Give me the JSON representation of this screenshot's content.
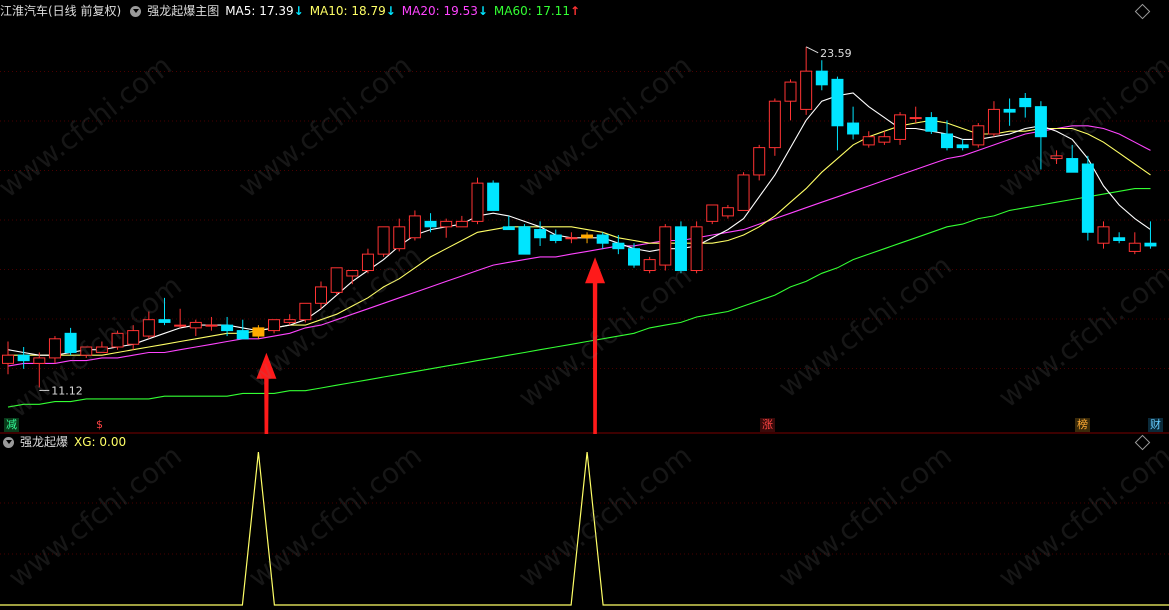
{
  "header": {
    "stock_name": "江淮汽车(日线 前复权)",
    "indicator_name": "强龙起爆主图",
    "ma": [
      {
        "label": "MA5: 17.39",
        "arrow": "↓",
        "color": "#ffffff",
        "arrow_color": "#00e5ff"
      },
      {
        "label": "MA10: 18.79",
        "arrow": "↓",
        "color": "#ffff66",
        "arrow_color": "#00e5ff"
      },
      {
        "label": "MA20: 19.53",
        "arrow": "↓",
        "color": "#ff44ff",
        "arrow_color": "#00e5ff"
      },
      {
        "label": "MA60: 17.11",
        "arrow": "↑",
        "color": "#33ff33",
        "arrow_color": "#ff3333"
      }
    ]
  },
  "sub_header": {
    "indicator_name": "强龙起爆",
    "xg_label": "XG: 0.00"
  },
  "badges": [
    {
      "text": "减",
      "color": "#33ff99"
    },
    {
      "text": "$",
      "color": "#ff4444"
    },
    {
      "text": "涨",
      "color": "#ff4444"
    },
    {
      "text": "榜",
      "color": "#ffaa33"
    },
    {
      "text": "财",
      "color": "#66ccff"
    }
  ],
  "watermark": "www.cfchi.com",
  "colors": {
    "up": "#ff3333",
    "down": "#00e5ff",
    "signal": "#ffaa00",
    "grid": "#4a0000",
    "ma5": "#ffffff",
    "ma10": "#ffff66",
    "ma20": "#ff44ff",
    "ma60": "#33ff33",
    "xg_line": "#ffff66",
    "arrow": "#ff1a1a"
  },
  "chart_data": [
    {
      "type": "candlestick",
      "title": "",
      "ylim": [
        10.0,
        24.5
      ],
      "high_label": "23.59",
      "low_label": "11.12",
      "candles": [
        {
          "o": 12.0,
          "h": 12.8,
          "l": 11.6,
          "c": 12.3
        },
        {
          "o": 12.3,
          "h": 12.6,
          "l": 11.8,
          "c": 12.1
        },
        {
          "o": 12.0,
          "h": 12.4,
          "l": 11.12,
          "c": 12.2
        },
        {
          "o": 12.2,
          "h": 13.0,
          "l": 12.0,
          "c": 12.9
        },
        {
          "o": 13.1,
          "h": 13.3,
          "l": 12.3,
          "c": 12.4
        },
        {
          "o": 12.3,
          "h": 12.6,
          "l": 12.2,
          "c": 12.6
        },
        {
          "o": 12.4,
          "h": 12.8,
          "l": 12.4,
          "c": 12.6
        },
        {
          "o": 12.6,
          "h": 13.2,
          "l": 12.5,
          "c": 13.1
        },
        {
          "o": 12.7,
          "h": 13.4,
          "l": 12.5,
          "c": 13.2
        },
        {
          "o": 13.0,
          "h": 13.9,
          "l": 12.9,
          "c": 13.6
        },
        {
          "o": 13.6,
          "h": 14.4,
          "l": 13.4,
          "c": 13.5
        },
        {
          "o": 13.4,
          "h": 14.0,
          "l": 13.3,
          "c": 13.4
        },
        {
          "o": 13.3,
          "h": 13.6,
          "l": 13.0,
          "c": 13.5
        },
        {
          "o": 13.4,
          "h": 13.7,
          "l": 13.2,
          "c": 13.4
        },
        {
          "o": 13.4,
          "h": 13.7,
          "l": 13.0,
          "c": 13.2
        },
        {
          "o": 13.2,
          "h": 13.6,
          "l": 12.9,
          "c": 12.9
        },
        {
          "o": 13.0,
          "h": 13.4,
          "l": 12.9,
          "c": 13.3
        },
        {
          "o": 13.2,
          "h": 13.6,
          "l": 13.1,
          "c": 13.6
        },
        {
          "o": 13.5,
          "h": 13.8,
          "l": 13.4,
          "c": 13.6
        },
        {
          "o": 13.6,
          "h": 14.2,
          "l": 13.5,
          "c": 14.2
        },
        {
          "o": 14.2,
          "h": 15.0,
          "l": 14.0,
          "c": 14.8
        },
        {
          "o": 14.6,
          "h": 15.5,
          "l": 14.5,
          "c": 15.5
        },
        {
          "o": 15.2,
          "h": 15.4,
          "l": 14.9,
          "c": 15.4
        },
        {
          "o": 15.4,
          "h": 16.2,
          "l": 15.3,
          "c": 16.0
        },
        {
          "o": 16.0,
          "h": 17.0,
          "l": 15.9,
          "c": 17.0
        },
        {
          "o": 16.2,
          "h": 17.3,
          "l": 16.1,
          "c": 17.0
        },
        {
          "o": 16.6,
          "h": 17.6,
          "l": 16.5,
          "c": 17.4
        },
        {
          "o": 17.2,
          "h": 17.5,
          "l": 16.8,
          "c": 17.0
        },
        {
          "o": 17.0,
          "h": 17.3,
          "l": 16.6,
          "c": 17.2
        },
        {
          "o": 17.0,
          "h": 17.4,
          "l": 17.0,
          "c": 17.2
        },
        {
          "o": 17.2,
          "h": 18.8,
          "l": 17.1,
          "c": 18.6
        },
        {
          "o": 18.6,
          "h": 18.7,
          "l": 17.6,
          "c": 17.6
        },
        {
          "o": 17.0,
          "h": 17.4,
          "l": 16.9,
          "c": 16.9
        },
        {
          "o": 17.0,
          "h": 17.1,
          "l": 16.0,
          "c": 16.0
        },
        {
          "o": 16.9,
          "h": 17.2,
          "l": 16.3,
          "c": 16.6
        },
        {
          "o": 16.7,
          "h": 16.9,
          "l": 16.4,
          "c": 16.5
        },
        {
          "o": 16.6,
          "h": 16.8,
          "l": 16.4,
          "c": 16.6
        },
        {
          "o": 16.6,
          "h": 16.8,
          "l": 16.4,
          "c": 16.7
        },
        {
          "o": 16.7,
          "h": 16.8,
          "l": 16.2,
          "c": 16.4
        },
        {
          "o": 16.4,
          "h": 16.7,
          "l": 16.0,
          "c": 16.2
        },
        {
          "o": 16.2,
          "h": 16.4,
          "l": 15.5,
          "c": 15.6
        },
        {
          "o": 15.4,
          "h": 15.9,
          "l": 15.3,
          "c": 15.8
        },
        {
          "o": 15.6,
          "h": 17.1,
          "l": 15.4,
          "c": 17.0
        },
        {
          "o": 17.0,
          "h": 17.2,
          "l": 15.3,
          "c": 15.4
        },
        {
          "o": 15.4,
          "h": 17.2,
          "l": 15.3,
          "c": 17.0
        },
        {
          "o": 17.2,
          "h": 17.8,
          "l": 17.1,
          "c": 17.8
        },
        {
          "o": 17.4,
          "h": 17.8,
          "l": 17.3,
          "c": 17.7
        },
        {
          "o": 17.6,
          "h": 19.0,
          "l": 17.6,
          "c": 18.9
        },
        {
          "o": 18.9,
          "h": 20.0,
          "l": 18.7,
          "c": 19.9
        },
        {
          "o": 19.9,
          "h": 21.7,
          "l": 19.6,
          "c": 21.6
        },
        {
          "o": 21.6,
          "h": 22.4,
          "l": 20.9,
          "c": 22.3
        },
        {
          "o": 21.3,
          "h": 23.59,
          "l": 21.1,
          "c": 22.7
        },
        {
          "o": 22.7,
          "h": 23.1,
          "l": 22.0,
          "c": 22.2
        },
        {
          "o": 22.4,
          "h": 22.5,
          "l": 19.8,
          "c": 20.7
        },
        {
          "o": 20.8,
          "h": 21.4,
          "l": 20.2,
          "c": 20.4
        },
        {
          "o": 20.0,
          "h": 20.5,
          "l": 19.9,
          "c": 20.3
        },
        {
          "o": 20.1,
          "h": 20.5,
          "l": 20.0,
          "c": 20.3
        },
        {
          "o": 20.2,
          "h": 21.2,
          "l": 20.0,
          "c": 21.1
        },
        {
          "o": 21.0,
          "h": 21.4,
          "l": 20.8,
          "c": 21.0
        },
        {
          "o": 21.0,
          "h": 21.2,
          "l": 20.4,
          "c": 20.5
        },
        {
          "o": 20.4,
          "h": 20.9,
          "l": 19.8,
          "c": 19.9
        },
        {
          "o": 20.0,
          "h": 20.2,
          "l": 19.8,
          "c": 19.9
        },
        {
          "o": 20.0,
          "h": 20.8,
          "l": 19.9,
          "c": 20.7
        },
        {
          "o": 20.4,
          "h": 21.6,
          "l": 20.3,
          "c": 21.3
        },
        {
          "o": 21.3,
          "h": 21.7,
          "l": 20.7,
          "c": 21.2
        },
        {
          "o": 21.7,
          "h": 21.9,
          "l": 21.0,
          "c": 21.4
        },
        {
          "o": 21.4,
          "h": 21.6,
          "l": 19.1,
          "c": 20.3
        },
        {
          "o": 19.5,
          "h": 19.8,
          "l": 19.3,
          "c": 19.6
        },
        {
          "o": 19.5,
          "h": 20.0,
          "l": 19.0,
          "c": 19.0
        },
        {
          "o": 19.3,
          "h": 19.6,
          "l": 16.5,
          "c": 16.8
        },
        {
          "o": 16.4,
          "h": 17.2,
          "l": 16.2,
          "c": 17.0
        },
        {
          "o": 16.6,
          "h": 16.8,
          "l": 16.4,
          "c": 16.5
        },
        {
          "o": 16.1,
          "h": 16.8,
          "l": 16.0,
          "c": 16.4
        },
        {
          "o": 16.4,
          "h": 17.2,
          "l": 16.2,
          "c": 16.3
        }
      ],
      "signal_candles": [
        16,
        37
      ],
      "ma5": [
        12.5,
        12.4,
        12.3,
        12.3,
        12.4,
        12.5,
        12.5,
        12.6,
        12.7,
        12.9,
        13.1,
        13.3,
        13.4,
        13.4,
        13.4,
        13.3,
        13.2,
        13.3,
        13.4,
        13.6,
        14.0,
        14.5,
        15.0,
        15.4,
        15.8,
        16.3,
        16.7,
        16.9,
        17.0,
        17.1,
        17.4,
        17.5,
        17.4,
        17.2,
        17.0,
        16.7,
        16.6,
        16.6,
        16.6,
        16.4,
        16.2,
        16.1,
        16.2,
        16.2,
        16.3,
        16.6,
        16.9,
        17.3,
        18.1,
        18.9,
        19.9,
        20.9,
        21.6,
        21.8,
        21.9,
        21.4,
        21.0,
        20.6,
        20.6,
        20.5,
        20.4,
        20.2,
        20.2,
        20.3,
        20.4,
        20.6,
        20.7,
        20.5,
        20.2,
        19.5,
        18.5,
        17.8,
        17.3,
        16.9
      ],
      "ma10": [
        12.3,
        12.3,
        12.3,
        12.3,
        12.3,
        12.3,
        12.3,
        12.4,
        12.5,
        12.6,
        12.7,
        12.8,
        12.9,
        13.0,
        13.1,
        13.1,
        13.2,
        13.3,
        13.4,
        13.4,
        13.6,
        13.8,
        14.1,
        14.4,
        14.8,
        15.1,
        15.5,
        15.9,
        16.2,
        16.5,
        16.8,
        16.9,
        17.0,
        17.0,
        17.0,
        17.0,
        17.0,
        16.9,
        16.8,
        16.6,
        16.5,
        16.4,
        16.4,
        16.4,
        16.4,
        16.4,
        16.5,
        16.7,
        17.0,
        17.4,
        17.9,
        18.4,
        19.0,
        19.5,
        20.0,
        20.3,
        20.5,
        20.7,
        20.8,
        20.9,
        20.8,
        20.6,
        20.4,
        20.4,
        20.5,
        20.5,
        20.6,
        20.6,
        20.6,
        20.4,
        20.1,
        19.7,
        19.3,
        18.9
      ],
      "ma20": [
        11.9,
        12.0,
        12.0,
        12.0,
        12.1,
        12.1,
        12.2,
        12.2,
        12.3,
        12.4,
        12.4,
        12.5,
        12.6,
        12.7,
        12.8,
        12.9,
        12.9,
        13.0,
        13.1,
        13.3,
        13.4,
        13.6,
        13.8,
        14.0,
        14.2,
        14.4,
        14.6,
        14.8,
        15.0,
        15.2,
        15.4,
        15.6,
        15.7,
        15.8,
        15.9,
        15.9,
        16.0,
        16.1,
        16.2,
        16.3,
        16.3,
        16.4,
        16.5,
        16.5,
        16.6,
        16.7,
        16.8,
        16.9,
        17.1,
        17.3,
        17.5,
        17.7,
        17.9,
        18.1,
        18.3,
        18.5,
        18.7,
        18.9,
        19.1,
        19.3,
        19.5,
        19.6,
        19.8,
        20.0,
        20.2,
        20.4,
        20.5,
        20.6,
        20.7,
        20.7,
        20.6,
        20.4,
        20.1,
        19.8
      ],
      "ma60": [
        10.4,
        10.5,
        10.5,
        10.6,
        10.6,
        10.7,
        10.7,
        10.7,
        10.7,
        10.7,
        10.8,
        10.8,
        10.8,
        10.8,
        10.8,
        10.9,
        10.9,
        10.9,
        11.0,
        11.0,
        11.1,
        11.2,
        11.3,
        11.4,
        11.5,
        11.6,
        11.7,
        11.8,
        11.9,
        12.0,
        12.1,
        12.2,
        12.3,
        12.4,
        12.5,
        12.6,
        12.7,
        12.8,
        12.9,
        13.0,
        13.1,
        13.3,
        13.4,
        13.5,
        13.7,
        13.8,
        13.9,
        14.1,
        14.3,
        14.5,
        14.8,
        15.0,
        15.3,
        15.5,
        15.8,
        16.0,
        16.2,
        16.4,
        16.6,
        16.8,
        17.0,
        17.1,
        17.3,
        17.4,
        17.6,
        17.7,
        17.8,
        17.9,
        18.0,
        18.1,
        18.2,
        18.3,
        18.4,
        18.4
      ]
    },
    {
      "type": "line",
      "title": "",
      "ylim": [
        0,
        1
      ],
      "series": [
        {
          "values": [
            0,
            0,
            0,
            0,
            0,
            0,
            0,
            0,
            0,
            0,
            0,
            0,
            0,
            0,
            0,
            0,
            1,
            0,
            0,
            0,
            0,
            0,
            0,
            0,
            0,
            0,
            0,
            0,
            0,
            0,
            0,
            0,
            0,
            0,
            0,
            0,
            0,
            1,
            0,
            0,
            0,
            0,
            0,
            0,
            0,
            0,
            0,
            0,
            0,
            0,
            0,
            0,
            0,
            0,
            0,
            0,
            0,
            0,
            0,
            0,
            0,
            0,
            0,
            0,
            0,
            0,
            0,
            0,
            0,
            0,
            0,
            0,
            0,
            0
          ]
        }
      ]
    }
  ]
}
